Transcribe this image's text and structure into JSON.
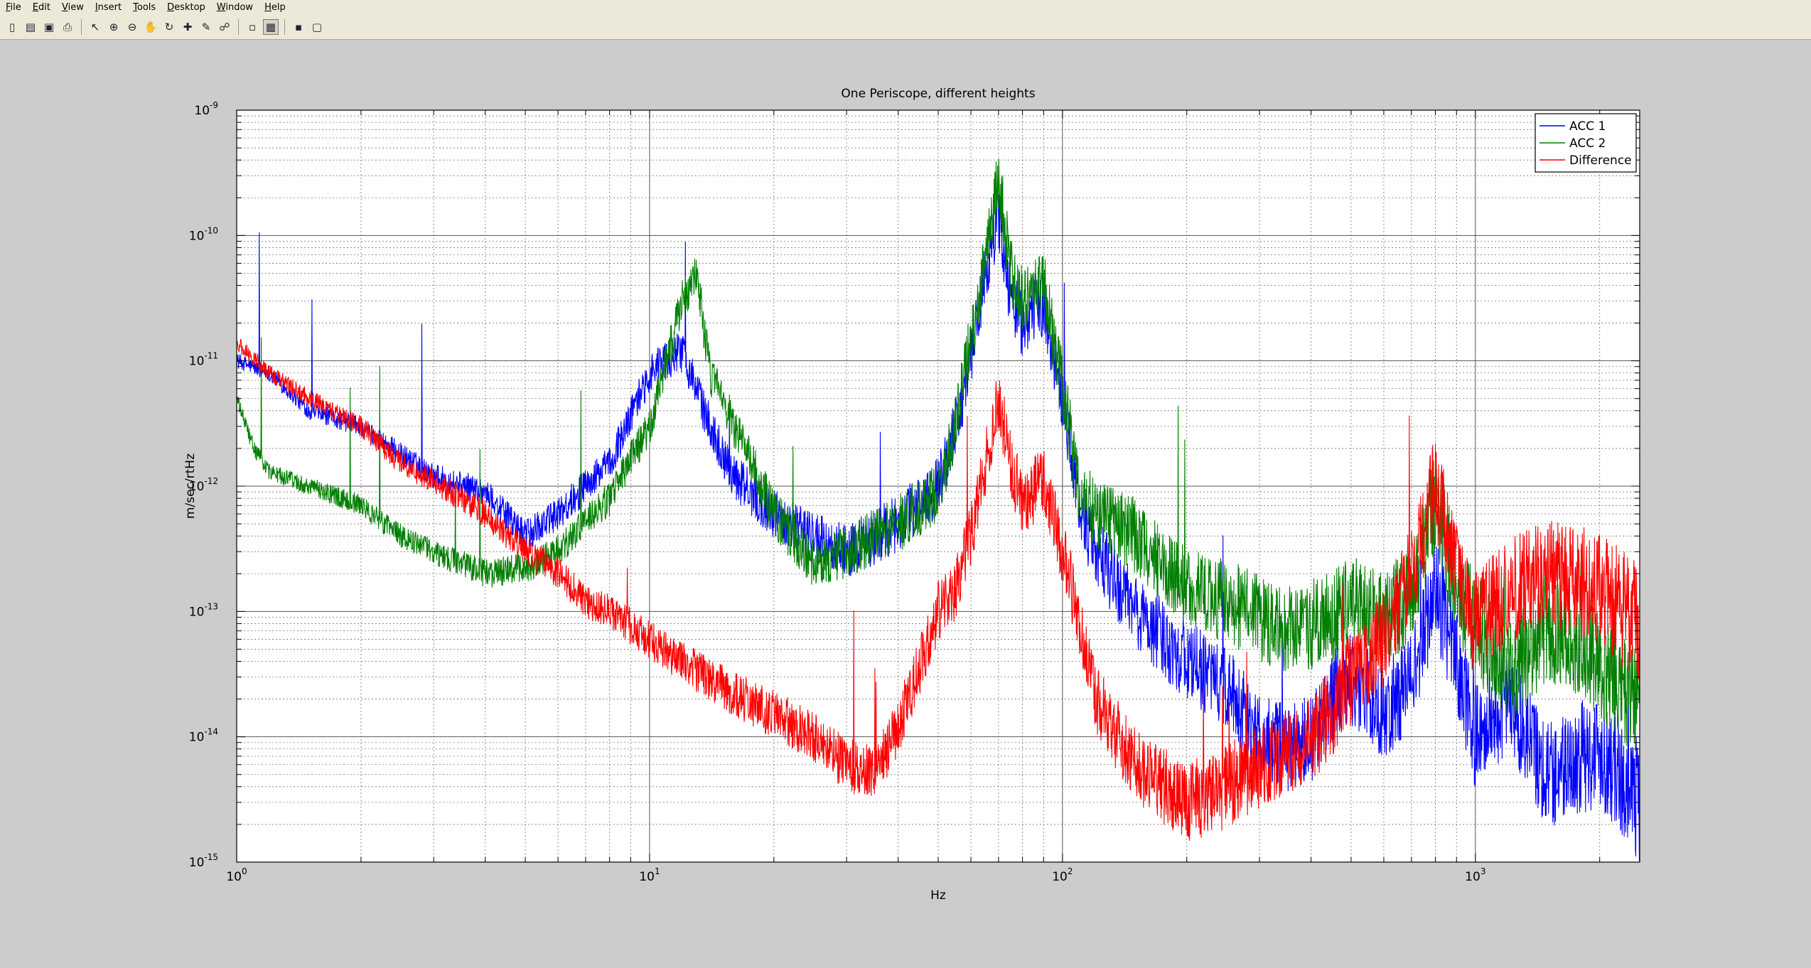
{
  "menu": {
    "items": [
      "File",
      "Edit",
      "View",
      "Insert",
      "Tools",
      "Desktop",
      "Window",
      "Help"
    ]
  },
  "toolbar": {
    "icons": [
      "new-figure",
      "open-file",
      "save-figure",
      "print-figure",
      "edit-plot",
      "zoom-in",
      "zoom-out",
      "pan",
      "rotate-3d",
      "data-cursor",
      "brush",
      "link-plot",
      "hide-plot-tools",
      "show-plot-tools",
      "insert-colorbar",
      "insert-legend"
    ]
  },
  "colors": {
    "acc1": "#0000ff",
    "acc2": "#007f00",
    "difference": "#ff0000"
  },
  "chart_data": {
    "type": "line",
    "title": "One Periscope, different heights",
    "xlabel": "Hz",
    "ylabel": "m/sec/rtHz",
    "xscale": "log",
    "yscale": "log",
    "xlim": [
      1,
      2500
    ],
    "ylim": [
      1e-15,
      1e-09
    ],
    "grid": true,
    "legend_position": "top-right",
    "x_ticks": [
      1,
      10,
      100,
      1000
    ],
    "y_ticks": [
      1e-15,
      1e-14,
      1e-13,
      1e-12,
      1e-11,
      1e-10,
      1e-09
    ],
    "series": [
      {
        "name": "ACC 1",
        "color": "#0000ff",
        "x": [
          1,
          1.2,
          1.5,
          2,
          2.5,
          3,
          4,
          5,
          6,
          7,
          8,
          10,
          12,
          14,
          16,
          20,
          25,
          30,
          40,
          50,
          55,
          60,
          65,
          70,
          75,
          80,
          90,
          100,
          110,
          120,
          150,
          200,
          250,
          300,
          350,
          400,
          450,
          500,
          600,
          700,
          800,
          900,
          1000,
          1200,
          1500,
          2000,
          2500
        ],
        "y": [
          1e-11,
          8e-12,
          4e-12,
          3e-12,
          1.8e-12,
          1.2e-12,
          9e-13,
          4e-13,
          6e-13,
          1e-12,
          1.5e-12,
          8e-12,
          1.2e-11,
          3e-12,
          1.2e-12,
          6e-13,
          4e-13,
          3e-13,
          5e-13,
          1e-12,
          3e-12,
          1e-11,
          5e-11,
          1.5e-10,
          3e-11,
          2e-11,
          3e-11,
          5e-12,
          7e-13,
          3e-13,
          1e-13,
          4e-14,
          2.5e-14,
          1e-14,
          8e-15,
          1e-14,
          2e-14,
          3e-14,
          1.5e-14,
          3e-14,
          1.5e-13,
          4e-14,
          1e-14,
          2e-14,
          5e-15,
          8e-15,
          3e-15
        ]
      },
      {
        "name": "ACC 2",
        "color": "#007f00",
        "x": [
          1,
          1.1,
          1.2,
          1.5,
          2,
          2.5,
          3,
          4,
          5,
          6,
          7,
          8,
          10,
          11,
          12,
          13,
          14,
          16,
          20,
          25,
          30,
          40,
          50,
          55,
          60,
          65,
          70,
          75,
          80,
          90,
          100,
          110,
          120,
          150,
          200,
          250,
          300,
          350,
          400,
          450,
          500,
          600,
          700,
          800,
          900,
          1000,
          1200,
          1500,
          2000,
          2500
        ],
        "y": [
          5e-12,
          2e-12,
          1.3e-12,
          1e-12,
          7e-13,
          4e-13,
          3e-13,
          2e-13,
          2.2e-13,
          3e-13,
          5e-13,
          8e-13,
          3e-12,
          1e-11,
          3e-11,
          5e-11,
          8e-12,
          3e-12,
          6e-13,
          2.5e-13,
          3e-13,
          5e-13,
          9e-13,
          3e-12,
          1.5e-11,
          6e-11,
          3e-10,
          5e-11,
          3e-11,
          4e-11,
          6e-12,
          9e-13,
          6e-13,
          4e-13,
          1.5e-13,
          1.2e-13,
          9e-14,
          7e-14,
          8e-14,
          9e-14,
          1.2e-13,
          8e-14,
          1.5e-13,
          8e-13,
          1.5e-13,
          8e-14,
          3e-14,
          8e-14,
          4e-14,
          2e-14
        ]
      },
      {
        "name": "Difference",
        "color": "#ff0000",
        "x": [
          1,
          1.2,
          1.5,
          2,
          2.5,
          3,
          4,
          5,
          6,
          7,
          8,
          10,
          12,
          15,
          20,
          25,
          30,
          35,
          40,
          50,
          55,
          60,
          65,
          70,
          75,
          80,
          90,
          100,
          110,
          120,
          150,
          200,
          250,
          300,
          350,
          400,
          450,
          500,
          600,
          700,
          800,
          900,
          1000,
          1200,
          1500,
          2000,
          2500
        ],
        "y": [
          1.4e-11,
          8e-12,
          5e-12,
          3e-12,
          1.5e-12,
          1.1e-12,
          6e-13,
          3e-13,
          2e-13,
          1.2e-13,
          1e-13,
          6e-14,
          4e-14,
          2.5e-14,
          1.5e-14,
          1e-14,
          6e-15,
          5e-15,
          1.2e-14,
          1e-13,
          1.5e-13,
          4e-13,
          1.5e-12,
          5e-12,
          1.5e-12,
          7e-13,
          1.2e-12,
          3e-13,
          8e-14,
          2e-14,
          6e-15,
          3e-15,
          4e-15,
          6e-15,
          8e-15,
          1e-14,
          1.5e-14,
          3e-14,
          6e-14,
          2e-13,
          1e-12,
          2e-13,
          8e-14,
          1.5e-13,
          2e-13,
          1.5e-13,
          8e-14
        ]
      }
    ]
  }
}
